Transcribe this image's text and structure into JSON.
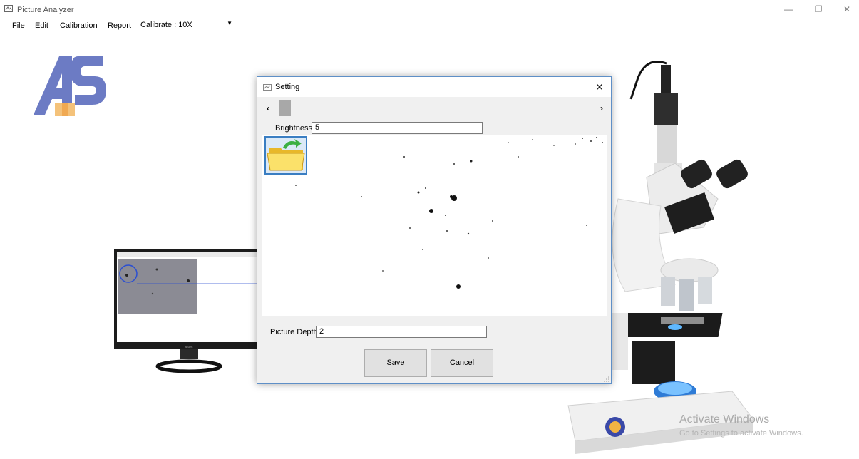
{
  "window": {
    "title": "Picture Analyzer",
    "controls": {
      "minimize": "—",
      "restore": "❐",
      "close": "✕"
    }
  },
  "menu": {
    "items": [
      "File",
      "Edit",
      "Calibration",
      "Report"
    ],
    "calibrate_value": "Calibrate : 10X"
  },
  "dialog": {
    "title": "Setting",
    "close_glyph": "✕",
    "scroll_left": "‹",
    "scroll_right": "›",
    "brightness_label": "Brightness",
    "brightness_value": "5",
    "picture_depth_label": "Picture Depth",
    "picture_depth_value": "2",
    "save_label": "Save",
    "cancel_label": "Cancel"
  },
  "watermark": {
    "title": "Activate Windows",
    "subtitle": "Go to Settings to activate Windows."
  },
  "colors": {
    "accent": "#3a7ec2",
    "logo_blue": "#6c7bc4",
    "logo_orange": "#f4c27a"
  }
}
